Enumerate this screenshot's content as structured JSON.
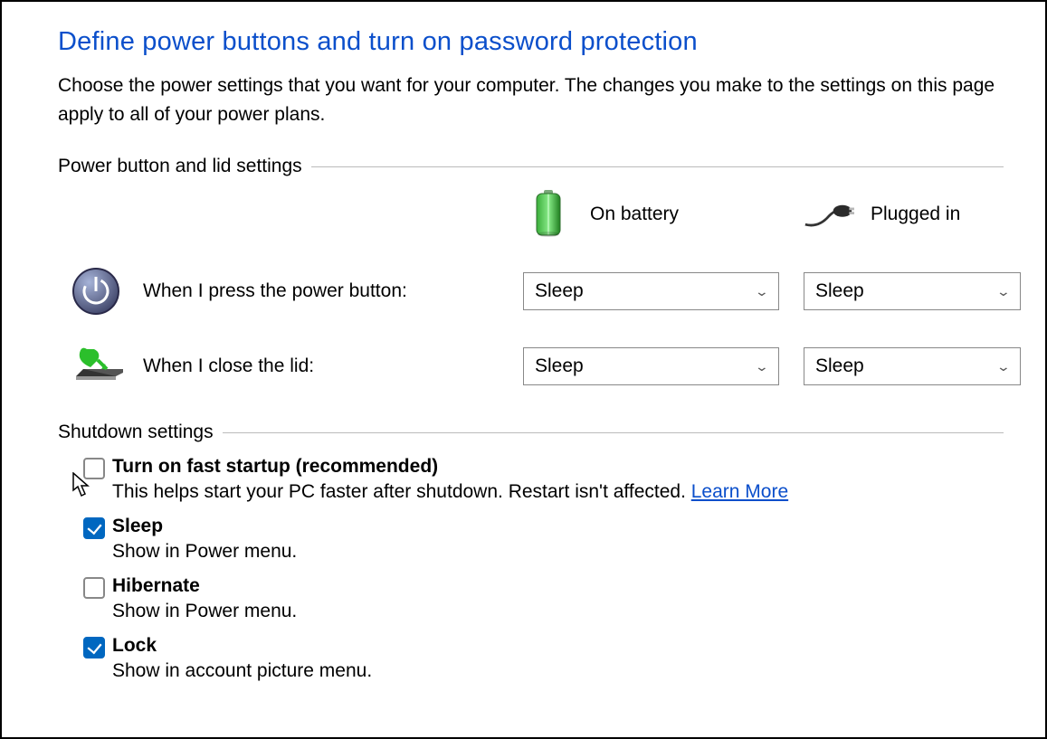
{
  "title": "Define power buttons and turn on password protection",
  "intro": "Choose the power settings that you want for your computer. The changes you make to the settings on this page apply to all of your power plans.",
  "sections": {
    "power": {
      "heading": "Power button and lid settings",
      "columns": {
        "battery": "On battery",
        "plugged": "Plugged in"
      },
      "rows": {
        "power_button": {
          "label": "When I press the power button:",
          "battery_value": "Sleep",
          "plugged_value": "Sleep"
        },
        "close_lid": {
          "label": "When I close the lid:",
          "battery_value": "Sleep",
          "plugged_value": "Sleep"
        }
      }
    },
    "shutdown": {
      "heading": "Shutdown settings",
      "items": {
        "fast_startup": {
          "checked": false,
          "title": "Turn on fast startup (recommended)",
          "desc": "This helps start your PC faster after shutdown. Restart isn't affected. ",
          "link": "Learn More"
        },
        "sleep": {
          "checked": true,
          "title": "Sleep",
          "desc": "Show in Power menu."
        },
        "hibernate": {
          "checked": false,
          "title": "Hibernate",
          "desc": "Show in Power menu."
        },
        "lock": {
          "checked": true,
          "title": "Lock",
          "desc": "Show in account picture menu."
        }
      }
    }
  }
}
